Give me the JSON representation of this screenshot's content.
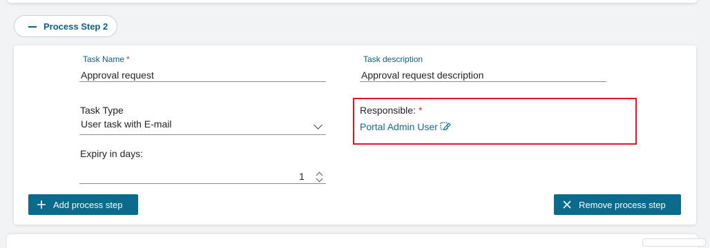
{
  "step": {
    "title": "Process Step 2",
    "collapse_icon": "minus-icon"
  },
  "fields": {
    "task_name": {
      "label": "Task Name",
      "required_mark": "*",
      "value": "Approval request"
    },
    "task_description": {
      "label": "Task description",
      "value": "Approval request description"
    },
    "task_type": {
      "label": "Task Type",
      "value": "User task with E-mail",
      "icon": "chevron-down-icon"
    },
    "responsible": {
      "label": "Responsible:",
      "required_mark": "*",
      "value": "Portal Admin User",
      "icon": "edit-icon"
    },
    "expiry": {
      "label": "Expiry in days:",
      "value": "1",
      "icon": "stepper-icon"
    }
  },
  "buttons": {
    "add_step": {
      "label": "Add process step",
      "icon": "plus-icon"
    },
    "remove_step": {
      "label": "Remove process step",
      "icon": "close-icon"
    }
  },
  "colors": {
    "accent": "#0a5f7f",
    "button_bg": "#0b6b8c",
    "required": "#d32f2f",
    "highlight": "#e3141b"
  }
}
